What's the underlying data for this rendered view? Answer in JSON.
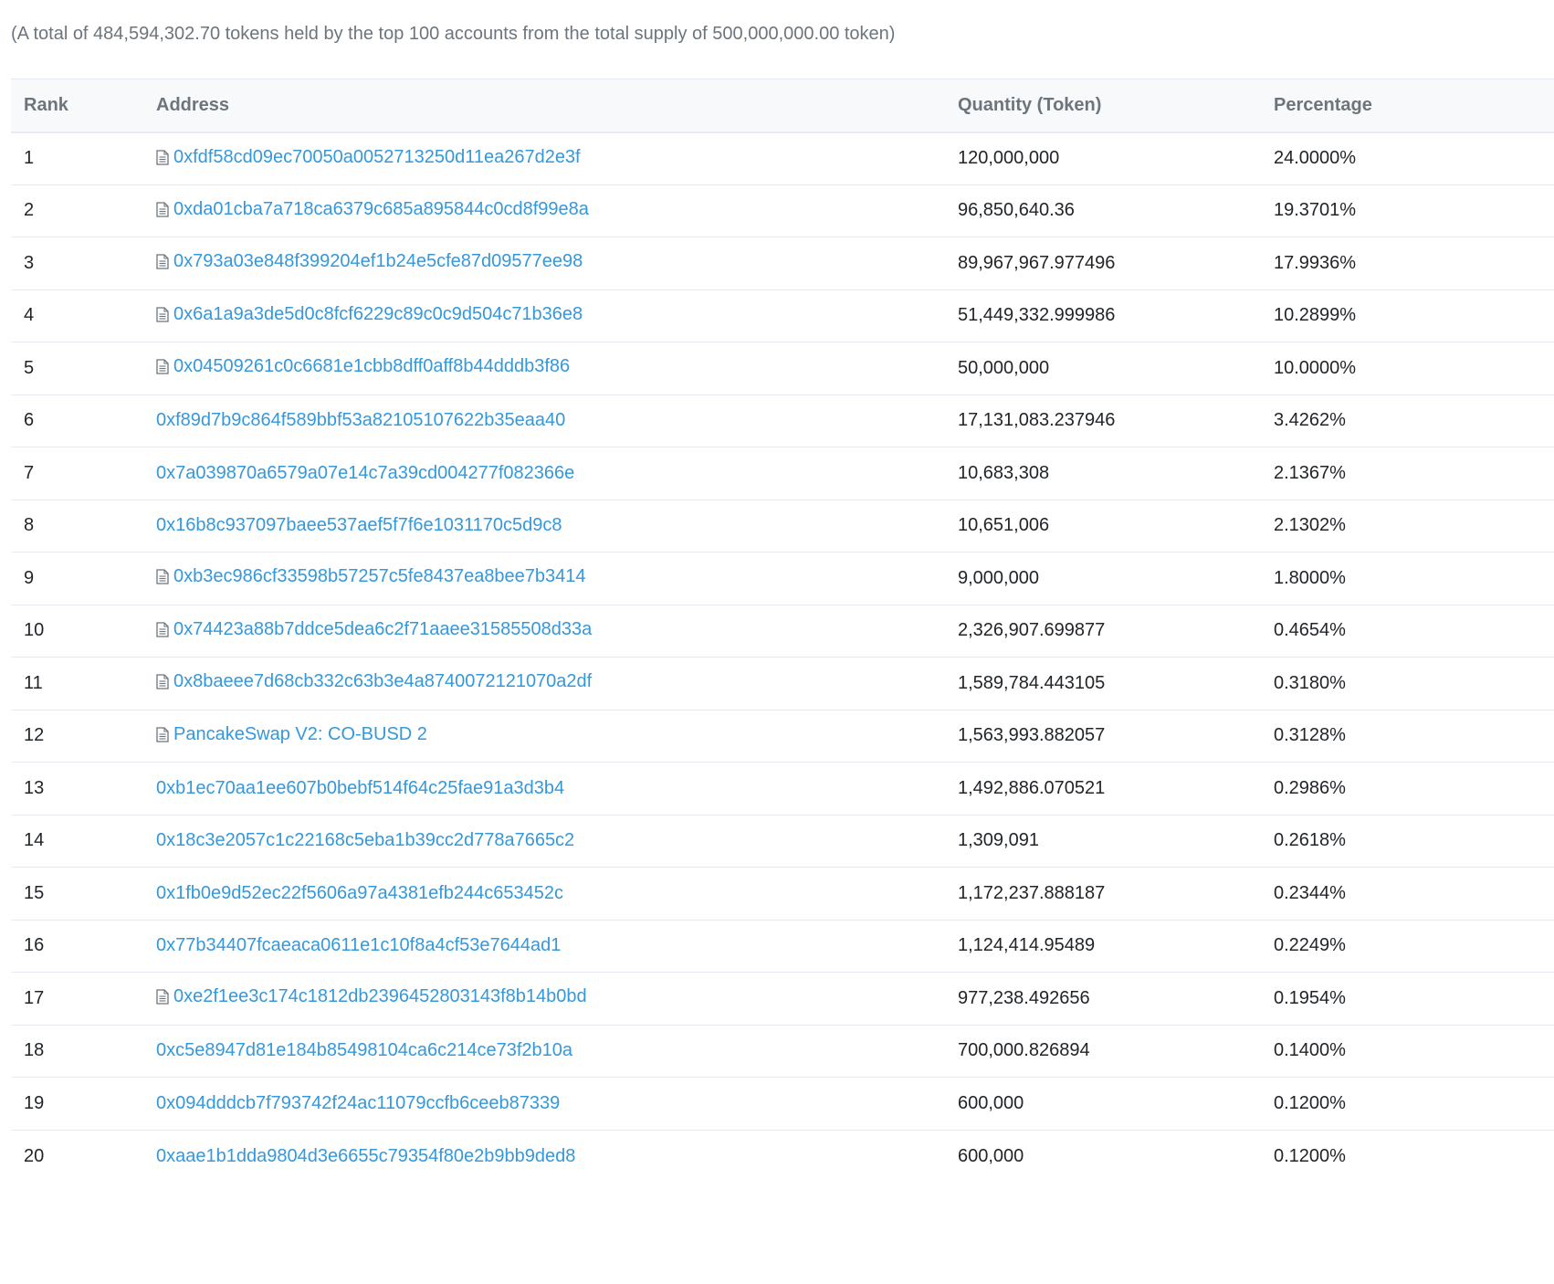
{
  "summary": "(A total of 484,594,302.70 tokens held by the top 100 accounts from the total supply of 500,000,000.00 token)",
  "table": {
    "headers": {
      "rank": "Rank",
      "address": "Address",
      "quantity": "Quantity (Token)",
      "percentage": "Percentage"
    },
    "rows": [
      {
        "rank": "1",
        "address": "0xfdf58cd09ec70050a0052713250d11ea267d2e3f",
        "is_contract": true,
        "quantity": "120,000,000",
        "percentage": "24.0000%"
      },
      {
        "rank": "2",
        "address": "0xda01cba7a718ca6379c685a895844c0cd8f99e8a",
        "is_contract": true,
        "quantity": "96,850,640.36",
        "percentage": "19.3701%"
      },
      {
        "rank": "3",
        "address": "0x793a03e848f399204ef1b24e5cfe87d09577ee98",
        "is_contract": true,
        "quantity": "89,967,967.977496",
        "percentage": "17.9936%"
      },
      {
        "rank": "4",
        "address": "0x6a1a9a3de5d0c8fcf6229c89c0c9d504c71b36e8",
        "is_contract": true,
        "quantity": "51,449,332.999986",
        "percentage": "10.2899%"
      },
      {
        "rank": "5",
        "address": "0x04509261c0c6681e1cbb8dff0aff8b44dddb3f86",
        "is_contract": true,
        "quantity": "50,000,000",
        "percentage": "10.0000%"
      },
      {
        "rank": "6",
        "address": "0xf89d7b9c864f589bbf53a82105107622b35eaa40",
        "is_contract": false,
        "quantity": "17,131,083.237946",
        "percentage": "3.4262%"
      },
      {
        "rank": "7",
        "address": "0x7a039870a6579a07e14c7a39cd004277f082366e",
        "is_contract": false,
        "quantity": "10,683,308",
        "percentage": "2.1367%"
      },
      {
        "rank": "8",
        "address": "0x16b8c937097baee537aef5f7f6e1031170c5d9c8",
        "is_contract": false,
        "quantity": "10,651,006",
        "percentage": "2.1302%"
      },
      {
        "rank": "9",
        "address": "0xb3ec986cf33598b57257c5fe8437ea8bee7b3414",
        "is_contract": true,
        "quantity": "9,000,000",
        "percentage": "1.8000%"
      },
      {
        "rank": "10",
        "address": "0x74423a88b7ddce5dea6c2f71aaee31585508d33a",
        "is_contract": true,
        "quantity": "2,326,907.699877",
        "percentage": "0.4654%"
      },
      {
        "rank": "11",
        "address": "0x8baeee7d68cb332c63b3e4a8740072121070a2df",
        "is_contract": true,
        "quantity": "1,589,784.443105",
        "percentage": "0.3180%"
      },
      {
        "rank": "12",
        "address": "PancakeSwap V2: CO-BUSD 2",
        "is_contract": true,
        "quantity": "1,563,993.882057",
        "percentage": "0.3128%"
      },
      {
        "rank": "13",
        "address": "0xb1ec70aa1ee607b0bebf514f64c25fae91a3d3b4",
        "is_contract": false,
        "quantity": "1,492,886.070521",
        "percentage": "0.2986%"
      },
      {
        "rank": "14",
        "address": "0x18c3e2057c1c22168c5eba1b39cc2d778a7665c2",
        "is_contract": false,
        "quantity": "1,309,091",
        "percentage": "0.2618%"
      },
      {
        "rank": "15",
        "address": "0x1fb0e9d52ec22f5606a97a4381efb244c653452c",
        "is_contract": false,
        "quantity": "1,172,237.888187",
        "percentage": "0.2344%"
      },
      {
        "rank": "16",
        "address": "0x77b34407fcaeaca0611e1c10f8a4cf53e7644ad1",
        "is_contract": false,
        "quantity": "1,124,414.95489",
        "percentage": "0.2249%"
      },
      {
        "rank": "17",
        "address": "0xe2f1ee3c174c1812db2396452803143f8b14b0bd",
        "is_contract": true,
        "quantity": "977,238.492656",
        "percentage": "0.1954%"
      },
      {
        "rank": "18",
        "address": "0xc5e8947d81e184b85498104ca6c214ce73f2b10a",
        "is_contract": false,
        "quantity": "700,000.826894",
        "percentage": "0.1400%"
      },
      {
        "rank": "19",
        "address": "0x094dddcb7f793742f24ac11079ccfb6ceeb87339",
        "is_contract": false,
        "quantity": "600,000",
        "percentage": "0.1200%"
      },
      {
        "rank": "20",
        "address": "0xaae1b1dda9804d3e6655c79354f80e2b9bb9ded8",
        "is_contract": false,
        "quantity": "600,000",
        "percentage": "0.1200%"
      }
    ]
  },
  "icons": {
    "contract": "document-icon"
  },
  "colors": {
    "link": "#3498db",
    "muted": "#6c757d",
    "border": "#e7eaf3"
  }
}
